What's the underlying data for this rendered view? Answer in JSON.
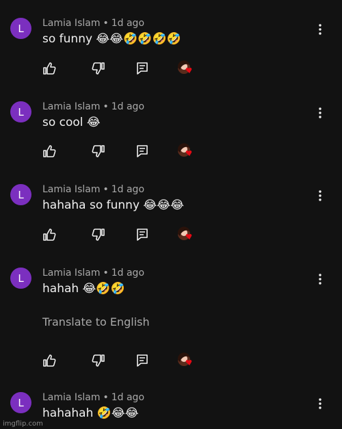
{
  "comments": [
    {
      "avatar_letter": "L",
      "author": "Lamia Islam",
      "separator": "•",
      "time": "1d ago",
      "text": "so funny 😂😂🤣🤣🤣🤣",
      "translate": ""
    },
    {
      "avatar_letter": "L",
      "author": "Lamia Islam",
      "separator": "•",
      "time": "1d ago",
      "text": "so cool 😂",
      "translate": ""
    },
    {
      "avatar_letter": "L",
      "author": "Lamia Islam",
      "separator": "•",
      "time": "1d ago",
      "text": "hahaha so funny 😂😂😂",
      "translate": ""
    },
    {
      "avatar_letter": "L",
      "author": "Lamia Islam",
      "separator": "•",
      "time": "1d ago",
      "text": "hahah 😂🤣🤣",
      "translate": "Translate to English"
    },
    {
      "avatar_letter": "L",
      "author": "Lamia Islam",
      "separator": "•",
      "time": "1d ago",
      "text": "hahahah 🤣😂😂",
      "translate": ""
    }
  ],
  "icons": {
    "like": "thumbs-up-icon",
    "dislike": "thumbs-down-icon",
    "reply": "reply-icon",
    "creator_heart": "creator-heart-icon",
    "more": "more-vertical-icon"
  },
  "colors": {
    "background": "#121212",
    "avatar": "#7b2fbf",
    "heart": "#e50914"
  },
  "watermark": "imgflip.com"
}
